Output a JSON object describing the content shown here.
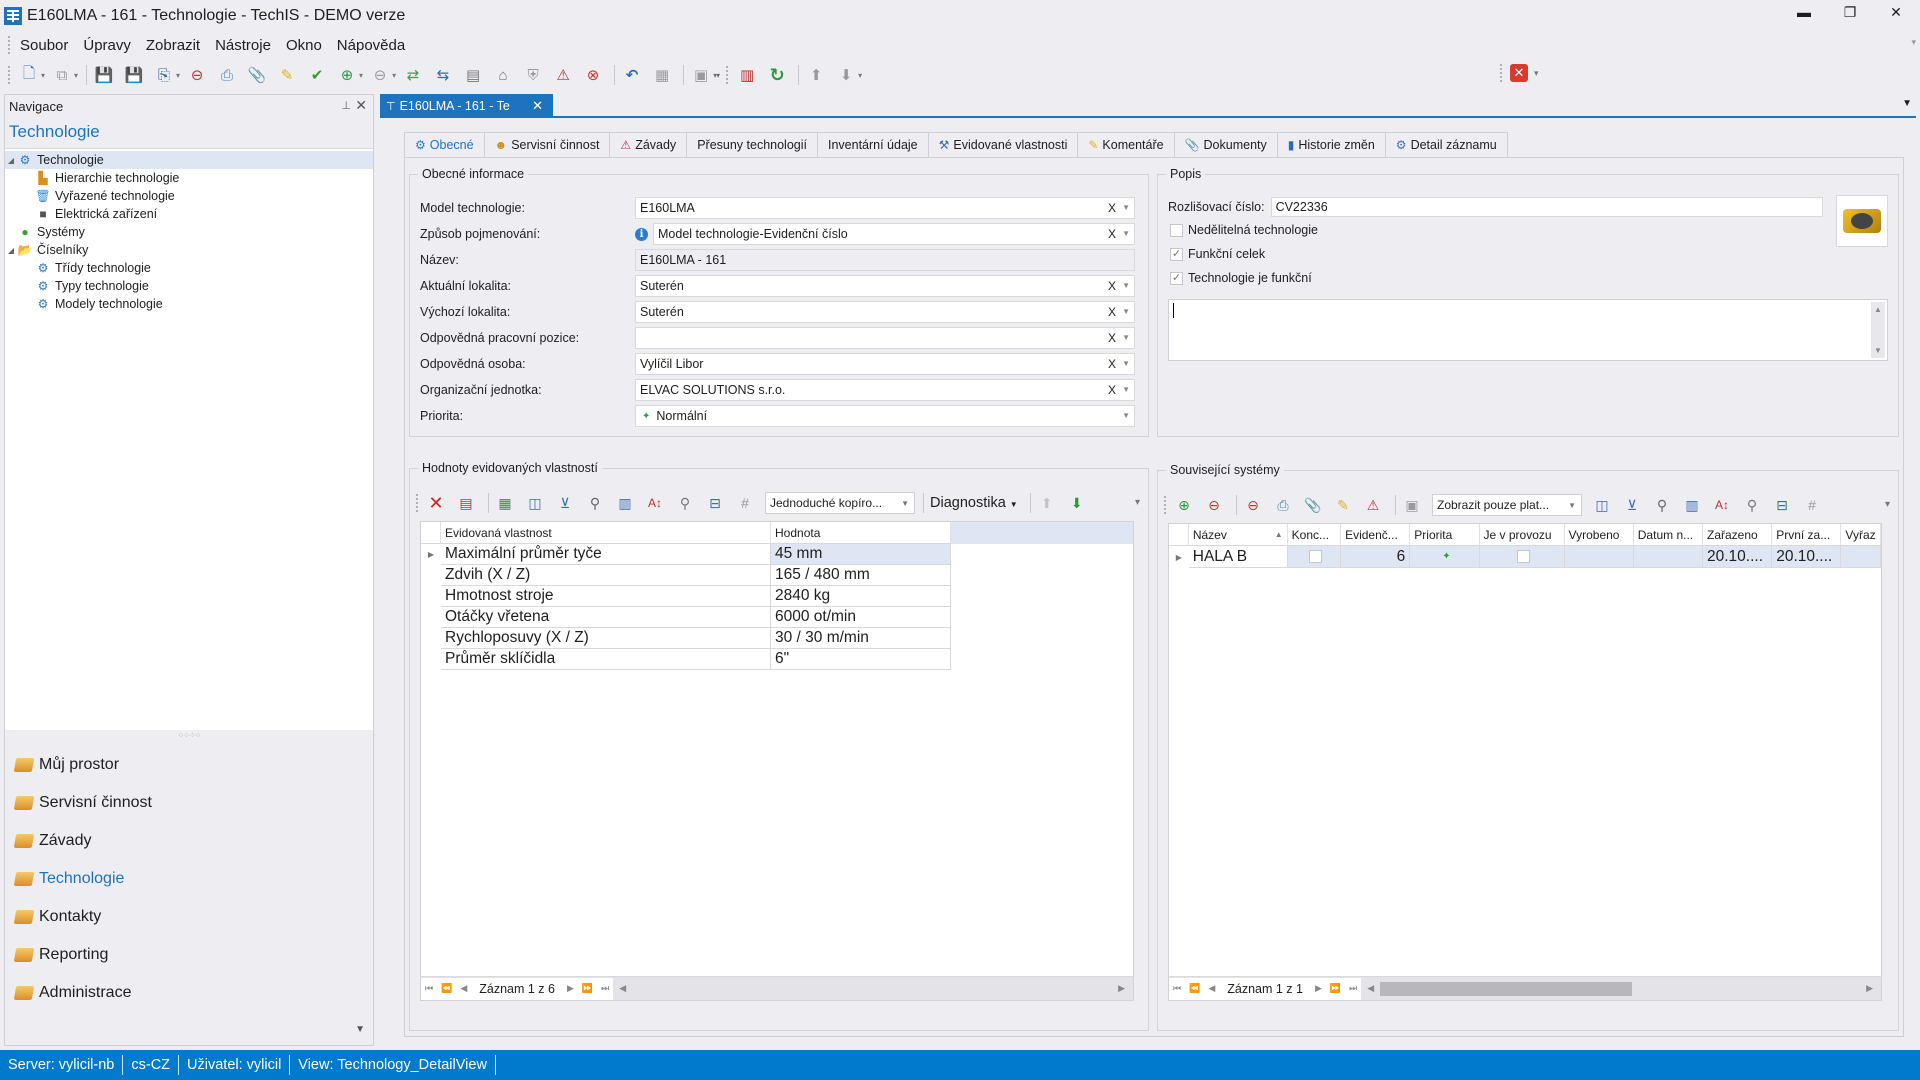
{
  "window": {
    "title": "E160LMA - 161 - Technologie - TechIS - DEMO verze",
    "controls": {
      "minimize": "minimize-icon",
      "restore": "restore-icon",
      "close": "close-icon"
    }
  },
  "menu": [
    "Soubor",
    "Úpravy",
    "Zobrazit",
    "Nástroje",
    "Okno",
    "Nápověda"
  ],
  "toolbar": {
    "icons": [
      "new-document-icon",
      "copy-icon",
      "save-icon",
      "save-and-close-icon",
      "save-and-new-icon",
      "delete-icon",
      "print-icon",
      "attachment-icon",
      "comment-icon",
      "validate-icon",
      "link-add-icon",
      "link-remove-icon",
      "transfer-icon",
      "swap-icon",
      "report-icon",
      "chart-report-icon",
      "security-icon",
      "view-error-icon",
      "unlink-icon",
      "undo-icon",
      "grid-icon",
      "export-icon",
      "book-icon",
      "refresh-icon",
      "move-up-icon",
      "move-down-icon"
    ],
    "close_all_icon": "close-red-icon"
  },
  "navigation": {
    "panel_title": "Navigace",
    "section_title": "Technologie",
    "tree": [
      {
        "label": "Technologie",
        "level": 0,
        "expanded": true,
        "selected": true,
        "icon": "technology-icon"
      },
      {
        "label": "Hierarchie technologie",
        "level": 1,
        "icon": "hierarchy-icon"
      },
      {
        "label": "Vyřazené technologie",
        "level": 1,
        "icon": "trash-icon"
      },
      {
        "label": "Elektrická zařízení",
        "level": 1,
        "icon": "electric-device-icon"
      },
      {
        "label": "Systémy",
        "level": 0,
        "icon": "systems-icon"
      },
      {
        "label": "Číselníky",
        "level": 0,
        "expanded": true,
        "icon": "folder-icon"
      },
      {
        "label": "Třídy technologie",
        "level": 1,
        "icon": "class-icon"
      },
      {
        "label": "Typy technologie",
        "level": 1,
        "icon": "type-icon"
      },
      {
        "label": "Modely technologie",
        "level": 1,
        "icon": "model-icon"
      }
    ],
    "groups": [
      {
        "label": "Můj prostor",
        "active": false
      },
      {
        "label": "Servisní činnost",
        "active": false
      },
      {
        "label": "Závady",
        "active": false
      },
      {
        "label": "Technologie",
        "active": true
      },
      {
        "label": "Kontakty",
        "active": false
      },
      {
        "label": "Reporting",
        "active": false
      },
      {
        "label": "Administrace",
        "active": false
      }
    ]
  },
  "document_tab": {
    "label": "E160LMA - 161 - Te"
  },
  "inner_tabs": [
    {
      "label": "Obecné",
      "icon": "technology-icon",
      "active": true
    },
    {
      "label": "Servisní činnost",
      "icon": "service-icon"
    },
    {
      "label": "Závady",
      "icon": "fault-icon"
    },
    {
      "label": "Přesuny technologií",
      "icon": ""
    },
    {
      "label": "Inventární údaje",
      "icon": ""
    },
    {
      "label": "Evidované vlastnosti",
      "icon": "properties-icon"
    },
    {
      "label": "Komentáře",
      "icon": "comment-icon"
    },
    {
      "label": "Dokumenty",
      "icon": "attachment-icon"
    },
    {
      "label": "Historie změn",
      "icon": "history-icon"
    },
    {
      "label": "Detail záznamu",
      "icon": "gear-icon"
    }
  ],
  "general_info": {
    "legend": "Obecné informace",
    "fields": [
      {
        "label": "Model technologie:",
        "value": "E160LMA",
        "clearable": true
      },
      {
        "label": "Způsob pojmenování:",
        "value": "Model technologie-Evidenční číslo",
        "clearable": true,
        "info": true
      },
      {
        "label": "Název:",
        "value": "E160LMA - 161",
        "readonly": true
      },
      {
        "label": "Aktuální lokalita:",
        "value": "Suterén",
        "clearable": true
      },
      {
        "label": "Výchozí lokalita:",
        "value": "Suterén",
        "clearable": true
      },
      {
        "label": "Odpovědná pracovní pozice:",
        "value": "",
        "clearable": true
      },
      {
        "label": "Odpovědná osoba:",
        "value": "Vylíčil Libor",
        "clearable": true
      },
      {
        "label": "Organizační jednotka:",
        "value": "ELVAC SOLUTIONS s.r.o.",
        "clearable": true
      },
      {
        "label": "Priorita:",
        "value": "Normální",
        "priority": true
      }
    ],
    "clear_symbol": "X",
    "arrow_symbol": "▾"
  },
  "description": {
    "legend": "Popis",
    "distinguishing_number_label": "Rozlišovací číslo:",
    "distinguishing_number_value": "CV22336",
    "checkboxes": [
      {
        "label": "Nedělitelná technologie",
        "checked": false
      },
      {
        "label": "Funkční celek",
        "checked": true
      },
      {
        "label": "Technologie je funkční",
        "checked": true
      }
    ],
    "note_value": ""
  },
  "properties": {
    "legend": "Hodnoty evidovaných vlastností",
    "copy_mode_combo": "Jednoduché kopíro...",
    "diagnostics_label": "Diagnostika",
    "columns": [
      "Evidovaná vlastnost",
      "Hodnota"
    ],
    "rows": [
      [
        "Maximální průměr tyče",
        "45 mm"
      ],
      [
        "Zdvih (X / Z)",
        "165 / 480 mm"
      ],
      [
        "Hmotnost stroje",
        "2840 kg"
      ],
      [
        "Otáčky vřetena",
        "6000 ot/min"
      ],
      [
        "Rychloposuvy (X / Z)",
        "30 / 30 m/min"
      ],
      [
        "Průměr sklíčidla",
        "6\""
      ]
    ],
    "record_info": "Záznam 1 z 6"
  },
  "related_systems": {
    "legend": "Související systémy",
    "filter_combo": "Zobrazit pouze plat...",
    "columns": [
      "Název",
      "Konc...",
      "Evidenč...",
      "Priorita",
      "Je v provozu",
      "Vyrobeno",
      "Datum n...",
      "Zařazeno",
      "První za...",
      "Vyřaz"
    ],
    "rows": [
      {
        "name": "HALA B",
        "konc": false,
        "evid": "6",
        "priority": "✦",
        "in_operation": false,
        "vyrobeno": "",
        "datum": "",
        "zarazeno": "20.10....",
        "prvni": "20.10....",
        "vyraz": ""
      }
    ],
    "record_info": "Záznam 1 z 1"
  },
  "statusbar": [
    "Server: vylicil-nb",
    "cs-CZ",
    "Uživatel: vylicil",
    "View: Technology_DetailView"
  ],
  "colors": {
    "accent": "#1e73be",
    "statusbar": "#007acc",
    "selection": "#dde6f2"
  }
}
